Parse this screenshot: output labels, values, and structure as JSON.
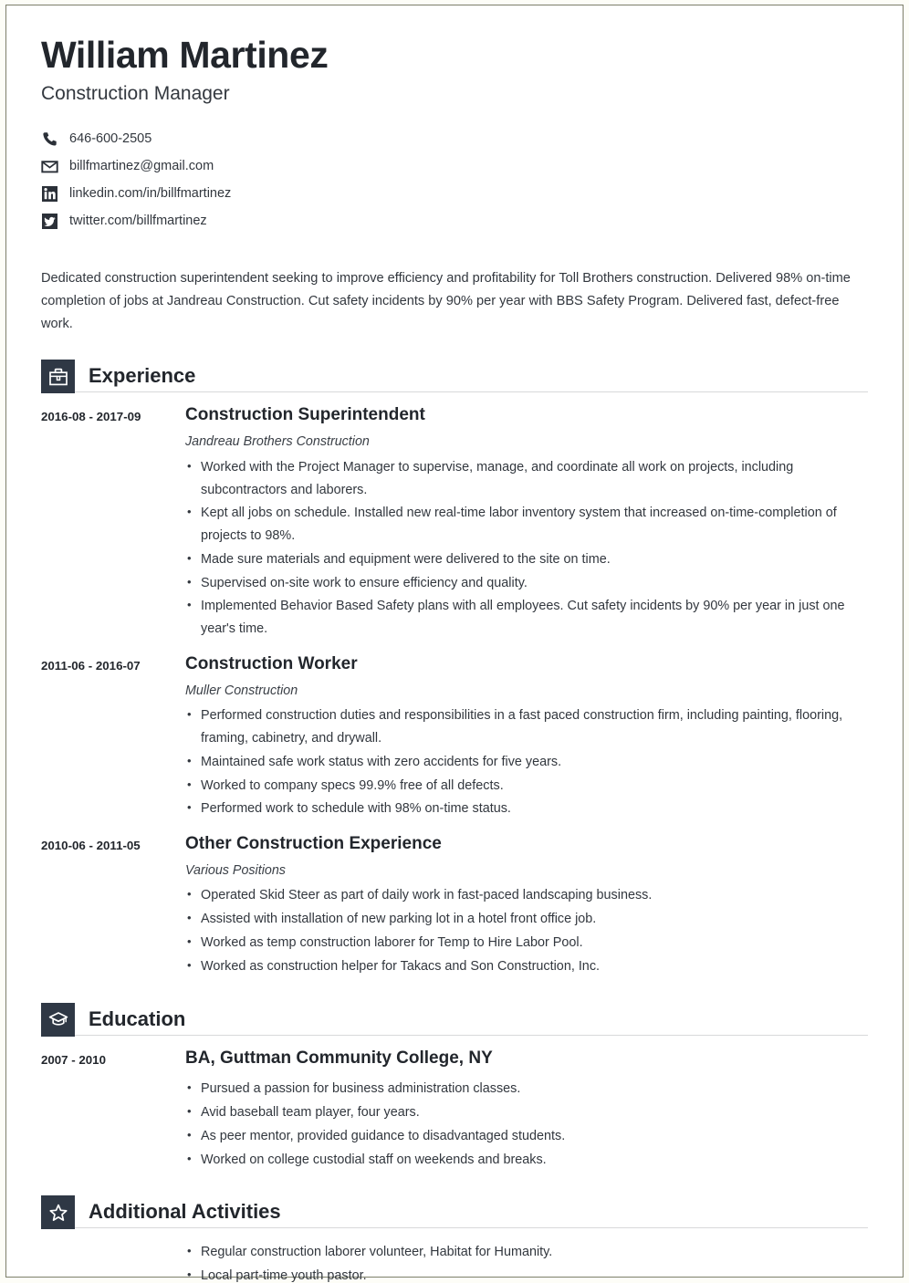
{
  "header": {
    "name": "William Martinez",
    "job_title": "Construction Manager",
    "contacts": [
      {
        "icon": "phone-icon",
        "text": "646-600-2505"
      },
      {
        "icon": "email-icon",
        "text": "billfmartinez@gmail.com"
      },
      {
        "icon": "linkedin-icon",
        "text": "linkedin.com/in/billfmartinez"
      },
      {
        "icon": "twitter-icon",
        "text": "twitter.com/billfmartinez"
      }
    ]
  },
  "summary": {
    "text": "Dedicated construction superintendent seeking to improve efficiency and profitability for Toll Brothers construction. Delivered 98% on-time completion of jobs at Jandreau Construction. Cut safety incidents by 90% per year with BBS Safety Program. Delivered fast, defect-free work."
  },
  "sections": {
    "experience": {
      "title": "Experience",
      "icon": "briefcase-icon",
      "entries": [
        {
          "dates": "2016-08 - 2017-09",
          "title": "Construction Superintendent",
          "org": "Jandreau Brothers Construction",
          "bullets": [
            "Worked with the Project Manager to supervise, manage, and coordinate all work on projects, including subcontractors and laborers.",
            "Kept all jobs on schedule. Installed new real-time labor inventory system that increased on-time-completion of projects to 98%.",
            "Made sure materials and equipment were delivered to the site on time.",
            "Supervised on-site work to ensure efficiency and quality.",
            "Implemented Behavior Based Safety plans with all employees. Cut safety incidents by 90% per year in just one year's time."
          ]
        },
        {
          "dates": "2011-06 - 2016-07",
          "title": "Construction Worker",
          "org": "Muller Construction",
          "bullets": [
            "Performed construction duties and responsibilities in a fast paced construction firm, including painting, flooring, framing, cabinetry, and drywall.",
            "Maintained safe work status with zero accidents for five years.",
            "Worked to company specs 99.9% free of all defects.",
            "Performed work to schedule with 98% on-time status."
          ]
        },
        {
          "dates": "2010-06 - 2011-05",
          "title": "Other Construction Experience",
          "org": "Various Positions",
          "bullets": [
            "Operated Skid Steer as part of daily work in fast-paced landscaping business.",
            "Assisted with installation of new parking lot in a hotel front office job.",
            "Worked as temp construction laborer for Temp to Hire Labor Pool.",
            "Worked as construction helper for Takacs and Son Construction, Inc."
          ]
        }
      ]
    },
    "education": {
      "title": "Education",
      "icon": "graduation-cap-icon",
      "entries": [
        {
          "dates": "2007 - 2010",
          "title": "BA, Guttman Community College, NY",
          "org": "",
          "bullets": [
            "Pursued a passion for business administration classes.",
            "Avid baseball team player, four years.",
            "As peer mentor, provided guidance to disadvantaged students.",
            "Worked on college custodial staff on weekends and breaks."
          ]
        }
      ]
    },
    "additional_activities": {
      "title": "Additional Activities",
      "icon": "star-icon",
      "bullets": [
        "Regular construction laborer volunteer, Habitat for Humanity.",
        "Local part-time youth pastor."
      ]
    }
  },
  "colors": {
    "badge": "#2f3845",
    "heading": "#22262c",
    "body_text": "#32373e",
    "rule": "#d8d9da",
    "page_border": "#7d7f6b"
  }
}
